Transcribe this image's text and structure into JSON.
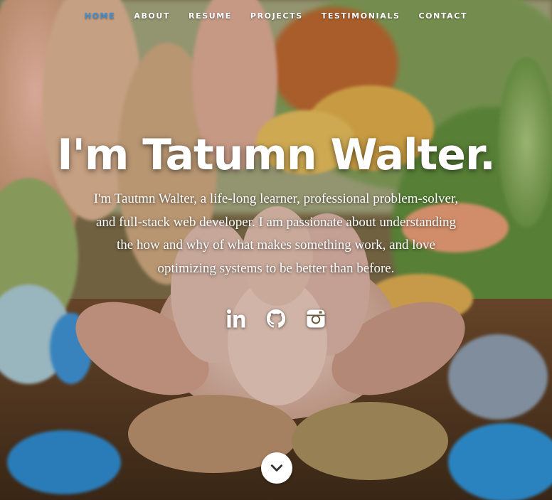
{
  "nav": {
    "items": [
      {
        "label": "HOME",
        "active": true
      },
      {
        "label": "ABOUT",
        "active": false
      },
      {
        "label": "RESUME",
        "active": false
      },
      {
        "label": "PROJECTS",
        "active": false
      },
      {
        "label": "TESTIMONIALS",
        "active": false
      },
      {
        "label": "CONTACT",
        "active": false
      }
    ],
    "active_color": "#3d8fd6"
  },
  "banner": {
    "headline": "I'm Tatumn Walter.",
    "intro": "I'm Tautmn Walter, a life-long learner, professional problem-solver, and full-stack web developer. I am passionate about understanding the how and why of what makes something work, and love optimizing systems to be better than before."
  },
  "social": [
    {
      "icon": "linkedin-icon"
    },
    {
      "icon": "github-icon"
    },
    {
      "icon": "instagram-icon"
    }
  ],
  "scroll": {
    "icon": "chevron-down-icon"
  }
}
